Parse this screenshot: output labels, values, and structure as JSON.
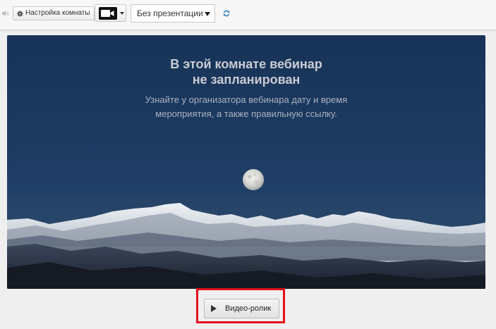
{
  "toolbar": {
    "room_settings_label": "Настройка комнаты",
    "presentation_select_value": "Без презентации",
    "icons": [
      "speaker-icon",
      "gear-icon",
      "camera-icon",
      "caret-down-icon",
      "select-arrow-icon",
      "refresh-icon"
    ],
    "refresh_color": "#2a7fc4"
  },
  "stage": {
    "title_line1": "В этой комнате вебинар",
    "title_line2": "не запланирован",
    "subtitle_line1": "Узнайте у организатора вебинара дату и время",
    "subtitle_line2": "мероприятия, а также правильную ссылку.",
    "background": "night-mountains-moon"
  },
  "video_button": {
    "label": "Видео-ролик",
    "icon": "play-icon",
    "highlight_color": "#e0101b"
  }
}
